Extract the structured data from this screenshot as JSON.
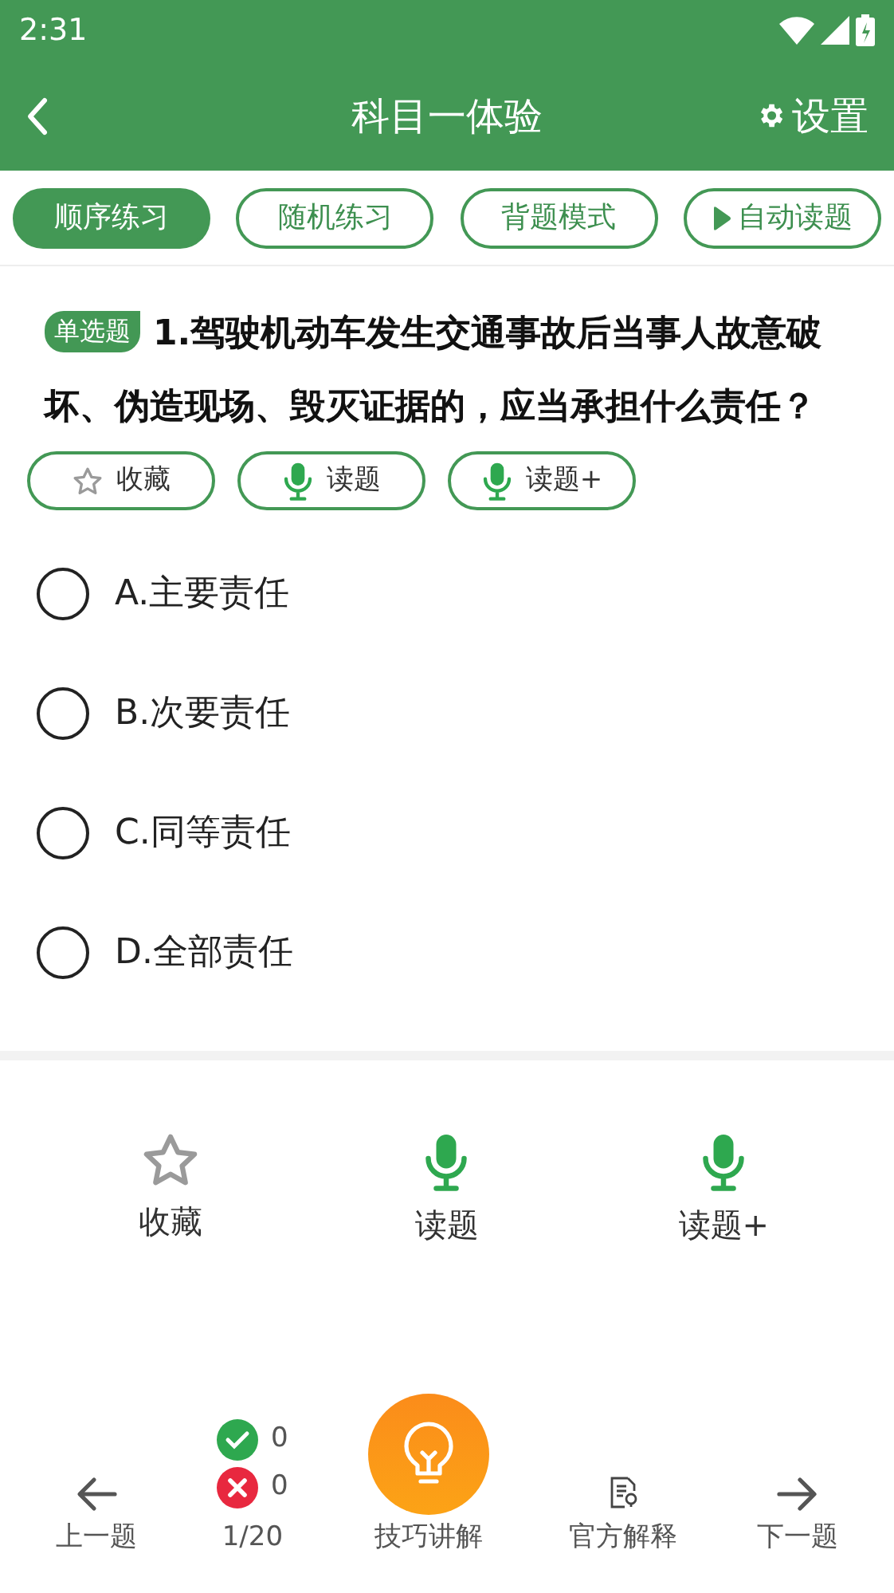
{
  "status_bar": {
    "time": "2:31"
  },
  "header": {
    "title": "科目一体验",
    "settings": "设置"
  },
  "tabs": [
    {
      "label": "顺序练习",
      "selected": true,
      "kind": "text"
    },
    {
      "label": "随机练习",
      "selected": false,
      "kind": "text"
    },
    {
      "label": "背题模式",
      "selected": false,
      "kind": "text"
    },
    {
      "label": "自动读题",
      "selected": false,
      "kind": "play"
    }
  ],
  "question": {
    "type_badge": "单选题",
    "text": "1.驾驶机动车发生交通事故后当事人故意破坏、伪造现场、毁灭证据的，应当承担什么责任？"
  },
  "question_actions": [
    {
      "label": "收藏",
      "kind": "star"
    },
    {
      "label": "读题",
      "kind": "mic"
    },
    {
      "label": "读题+",
      "kind": "mic"
    }
  ],
  "options": [
    {
      "label": "A.主要责任",
      "selected": false
    },
    {
      "label": "B.次要责任",
      "selected": false
    },
    {
      "label": "C.同等责任",
      "selected": false
    },
    {
      "label": "D.全部责任",
      "selected": false
    }
  ],
  "actions": [
    {
      "label": "收藏",
      "kind": "star"
    },
    {
      "label": "读题",
      "kind": "mic"
    },
    {
      "label": "读题+",
      "kind": "mic"
    }
  ],
  "bottom_bar": {
    "previous": "上一题",
    "correct_count": "0",
    "wrong_count": "0",
    "progress": "1/20",
    "tips": "技巧讲解",
    "official": "官方解释",
    "next": "下一题"
  }
}
